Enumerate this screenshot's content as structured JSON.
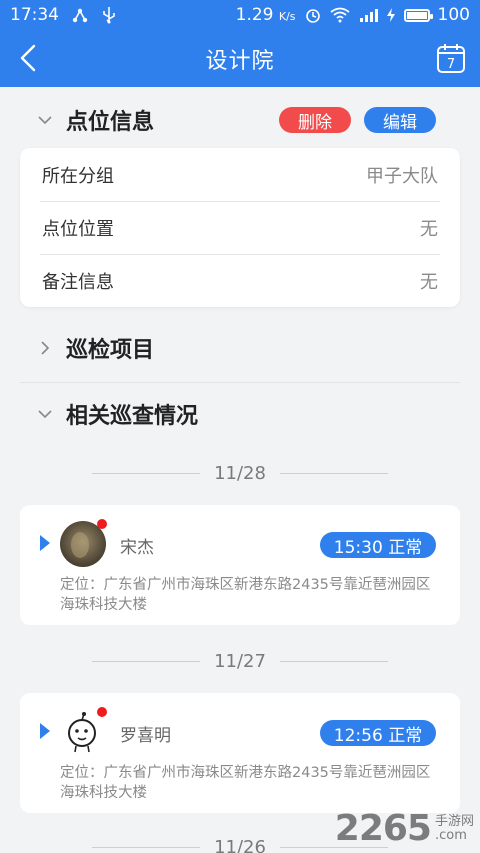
{
  "status_bar": {
    "time": "17:34",
    "speed": "1.29",
    "speed_unit": "K/s",
    "battery": "100"
  },
  "header": {
    "title": "设计院",
    "calendar_day": "7"
  },
  "point_info": {
    "heading": "点位信息",
    "delete_label": "删除",
    "edit_label": "编辑",
    "rows": [
      {
        "key": "所在分组",
        "value": "甲子大队"
      },
      {
        "key": "点位位置",
        "value": "无"
      },
      {
        "key": "备注信息",
        "value": "无"
      }
    ]
  },
  "inspect_items": {
    "heading": "巡检项目"
  },
  "related": {
    "heading": "相关巡查情况",
    "groups": [
      {
        "date": "11/28",
        "name": "宋杰",
        "status": "15:30 正常",
        "address": "定位：广东省广州市海珠区新港东路2435号靠近琶洲园区海珠科技大楼"
      },
      {
        "date": "11/27",
        "name": "罗喜明",
        "status": "12:56 正常",
        "address": "定位：广东省广州市海珠区新港东路2435号靠近琶洲园区海珠科技大楼"
      },
      {
        "date": "11/26"
      }
    ]
  },
  "watermark": {
    "brand": "2265",
    "sub1": "手游网",
    "sub2": ".com"
  },
  "colors": {
    "primary": "#2f80ed",
    "danger": "#f24b4b"
  }
}
